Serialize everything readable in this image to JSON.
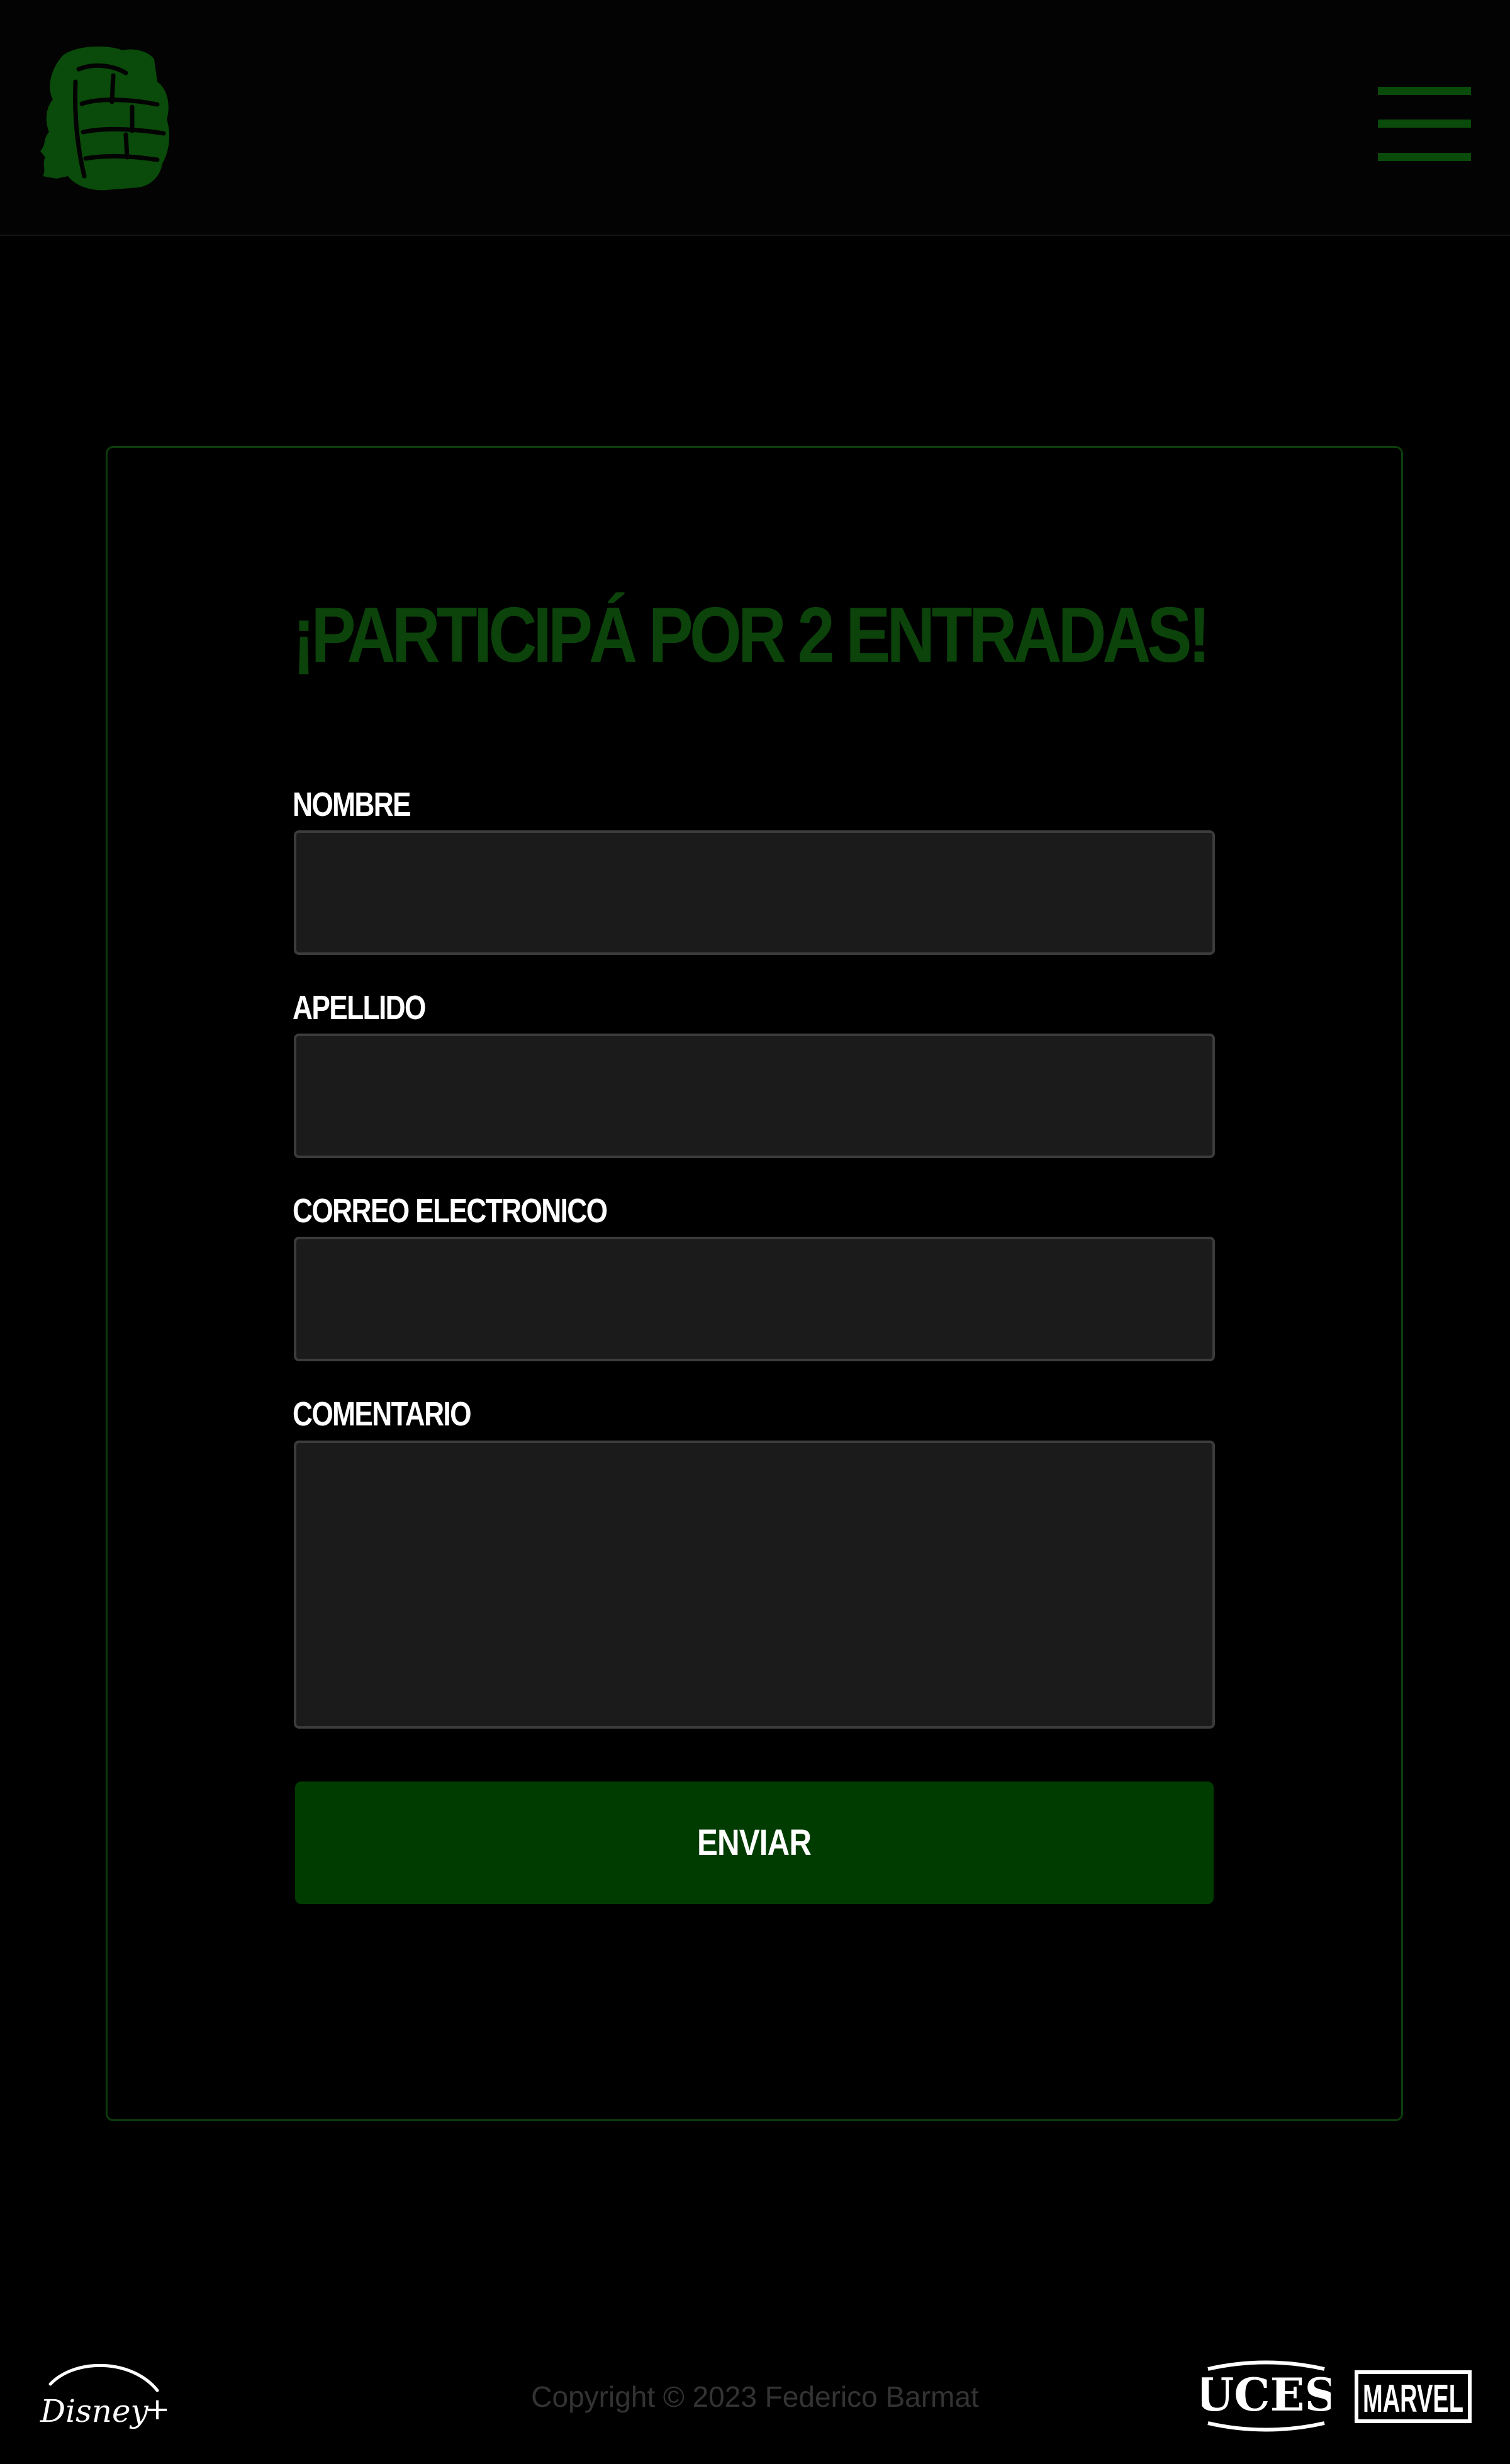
{
  "header": {
    "logo_name": "hulk-fist-logo",
    "menu_icon": "hamburger-menu-icon"
  },
  "form": {
    "title": "¡PARTICIPÁ POR 2 ENTRADAS!",
    "fields": [
      {
        "label": "NOMBRE",
        "value": ""
      },
      {
        "label": "APELLIDO",
        "value": ""
      },
      {
        "label": "CORREO ELECTRONICO",
        "value": ""
      },
      {
        "label": "COMENTARIO",
        "value": ""
      }
    ],
    "submit_label": "ENVIAR"
  },
  "footer": {
    "copyright": "Copyright © 2023 Federico Barmat",
    "logos": [
      "Disney+",
      "UCES",
      "MARVEL"
    ]
  },
  "colors": {
    "background": "#000000",
    "accent_green": "#0b430b",
    "button_green": "#003c00",
    "input_background": "#1b1b1b",
    "input_border": "#3c3c3c",
    "label_text": "#ffffff",
    "copyright_text": "#333333"
  }
}
